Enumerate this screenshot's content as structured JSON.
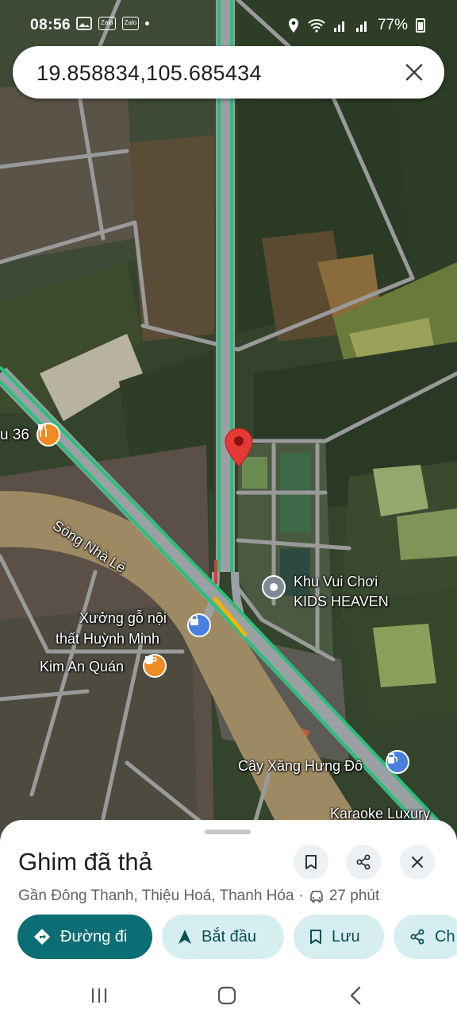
{
  "status_bar": {
    "time": "08:56",
    "notif_icons": [
      "image-icon",
      "Zalo",
      "Zalo"
    ],
    "battery": "77%"
  },
  "search": {
    "value": "19.858834,105.685434"
  },
  "map": {
    "labels": {
      "restaurant_partial": "u 36",
      "river": "Sông Nhà Lê",
      "kids_heaven_line1": "Khu Vui Chơi",
      "kids_heaven_line2": "KIDS HEAVEN",
      "xuong_go_line1": "Xưởng gỗ nội",
      "xuong_go_line2": "thất Huỳnh Minh",
      "kim_an": "Kim An Quán",
      "cay_xang": "Cây Xăng Hưng Đô",
      "karaoke": "Karaoke Luxury"
    }
  },
  "sheet": {
    "title": "Ghim đã thả",
    "location": "Gần Đông Thanh, Thiệu Hoá, Thanh Hóa",
    "separator": "·",
    "drive_time": "27 phút",
    "chips": {
      "directions": "Đường đi",
      "start": "Bắt đầu",
      "save": "Lưu",
      "share": "Ch"
    }
  },
  "colors": {
    "primary_chip": "#0b6e74",
    "secondary_chip": "#d7eef0",
    "pin": "#e53935"
  }
}
